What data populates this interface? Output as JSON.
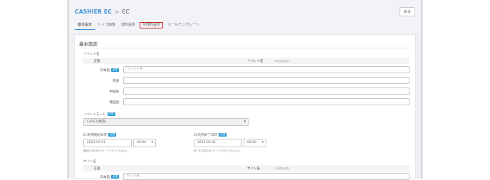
{
  "breadcrumb": {
    "root": "CASHIER EC",
    "separator": ">",
    "current": "EC"
  },
  "back_button": "戻る",
  "tabs": [
    {
      "label": "基本設定"
    },
    {
      "label": "トップ画像"
    },
    {
      "label": "送料設定"
    },
    {
      "label": "手数料設定"
    },
    {
      "label": "メールテンプレート"
    }
  ],
  "section_title": "基本設定",
  "event_name": {
    "label": "イベント名",
    "header_lang": "言語",
    "header_name": "イベント名",
    "header_sub": "128文字以内",
    "rows": [
      {
        "lang": "日本語",
        "required": "必須",
        "placeholder": "イベント名"
      },
      {
        "lang": "英語",
        "placeholder": ""
      },
      {
        "lang": "中国語",
        "placeholder": ""
      },
      {
        "lang": "韓国語",
        "placeholder": ""
      }
    ]
  },
  "event_mode": {
    "label": "イベントモード",
    "required": "必須",
    "value": "CASE3(製造)"
  },
  "start": {
    "label": "EC利用開始日時",
    "required": "必須",
    "date": "2023-02-01",
    "time": "00:00",
    "hint": "開始日の前はECサイトアクセスできません。"
  },
  "end": {
    "label": "EC利用終了日時",
    "required": "必須",
    "date": "2023-03-31",
    "time": "00:00",
    "hint": "終了日の翌日はECサイトアクセスできません。"
  },
  "site_name": {
    "label": "サイト名",
    "header_lang": "言語",
    "header_name": "サイト名",
    "header_sub": "128文字以内",
    "row_lang": "日本語",
    "required": "必須",
    "placeholder": "サイト名"
  },
  "colors": {
    "accent": "#3a8fd6",
    "badge": "#2a9ad3",
    "highlight": "#d31b1b"
  },
  "icons": {
    "caret": "chevron-down-icon"
  }
}
